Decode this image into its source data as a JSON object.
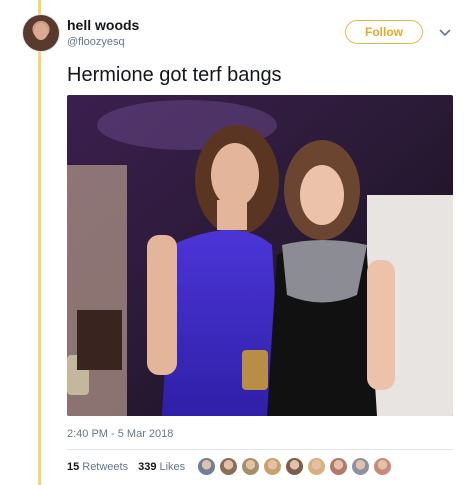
{
  "user": {
    "display_name": "hell woods",
    "handle": "@floozyesq"
  },
  "follow_label": "Follow",
  "tweet": {
    "text": "Hermione got terf bangs",
    "timestamp": "2:40 PM - 5 Mar 2018"
  },
  "stats": {
    "retweets_count": "15",
    "retweets_label": "Retweets",
    "likes_count": "339",
    "likes_label": "Likes"
  },
  "liker_colors": [
    "#6e7f9a",
    "#8a6d5a",
    "#a58f6b",
    "#c9a26b",
    "#7c5e4e",
    "#d8b07c",
    "#b5776a",
    "#8f8fa8",
    "#c98a7a"
  ]
}
